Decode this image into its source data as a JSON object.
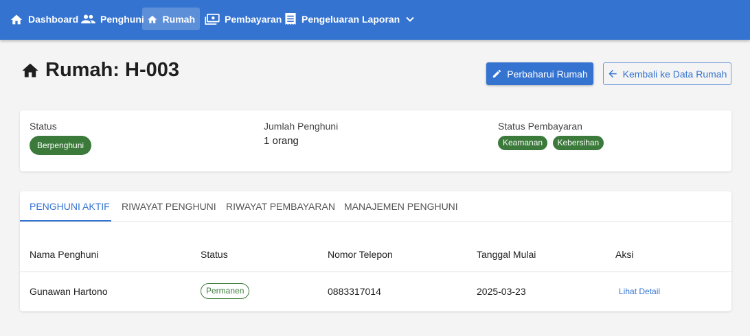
{
  "nav": {
    "items": [
      {
        "label": "Dashboard",
        "icon": "home-icon"
      },
      {
        "label": "Penghuni",
        "icon": "people-icon"
      },
      {
        "label": "Rumah",
        "icon": "home-icon"
      },
      {
        "label": "Pembayaran",
        "icon": "payment-icon"
      },
      {
        "label": "Pengeluaran",
        "icon": "receipt-icon"
      },
      {
        "label": "Laporan",
        "icon": "chevron-down-icon"
      }
    ],
    "active": "Rumah"
  },
  "page": {
    "title": "Rumah: H-003",
    "update_button": "Perbaharui Rumah",
    "back_button": "Kembali ke Data Rumah"
  },
  "info": {
    "status_label": "Status",
    "status_value": "Berpenghuni",
    "occupants_label": "Jumlah Penghuni",
    "occupants_value": "1 orang",
    "payment_label": "Status Pembayaran",
    "payment_chips": [
      "Keamanan",
      "Kebersihan"
    ]
  },
  "tabs": [
    "PENGHUNI AKTIF",
    "RIWAYAT PENGHUNI",
    "RIWAYAT PEMBAYARAN",
    "MANAJEMEN PENGHUNI"
  ],
  "table": {
    "headers": [
      "Nama Penghuni",
      "Status",
      "Nomor Telepon",
      "Tanggal Mulai",
      "Aksi"
    ],
    "rows": [
      {
        "name": "Gunawan Hartono",
        "status": "Permanen",
        "phone": "0883317014",
        "start_date": "2025-03-23",
        "action": "Lihat Detail"
      }
    ]
  },
  "colors": {
    "primary": "#3573d0",
    "success": "#3b7a3b",
    "background": "#f4f4f4"
  }
}
